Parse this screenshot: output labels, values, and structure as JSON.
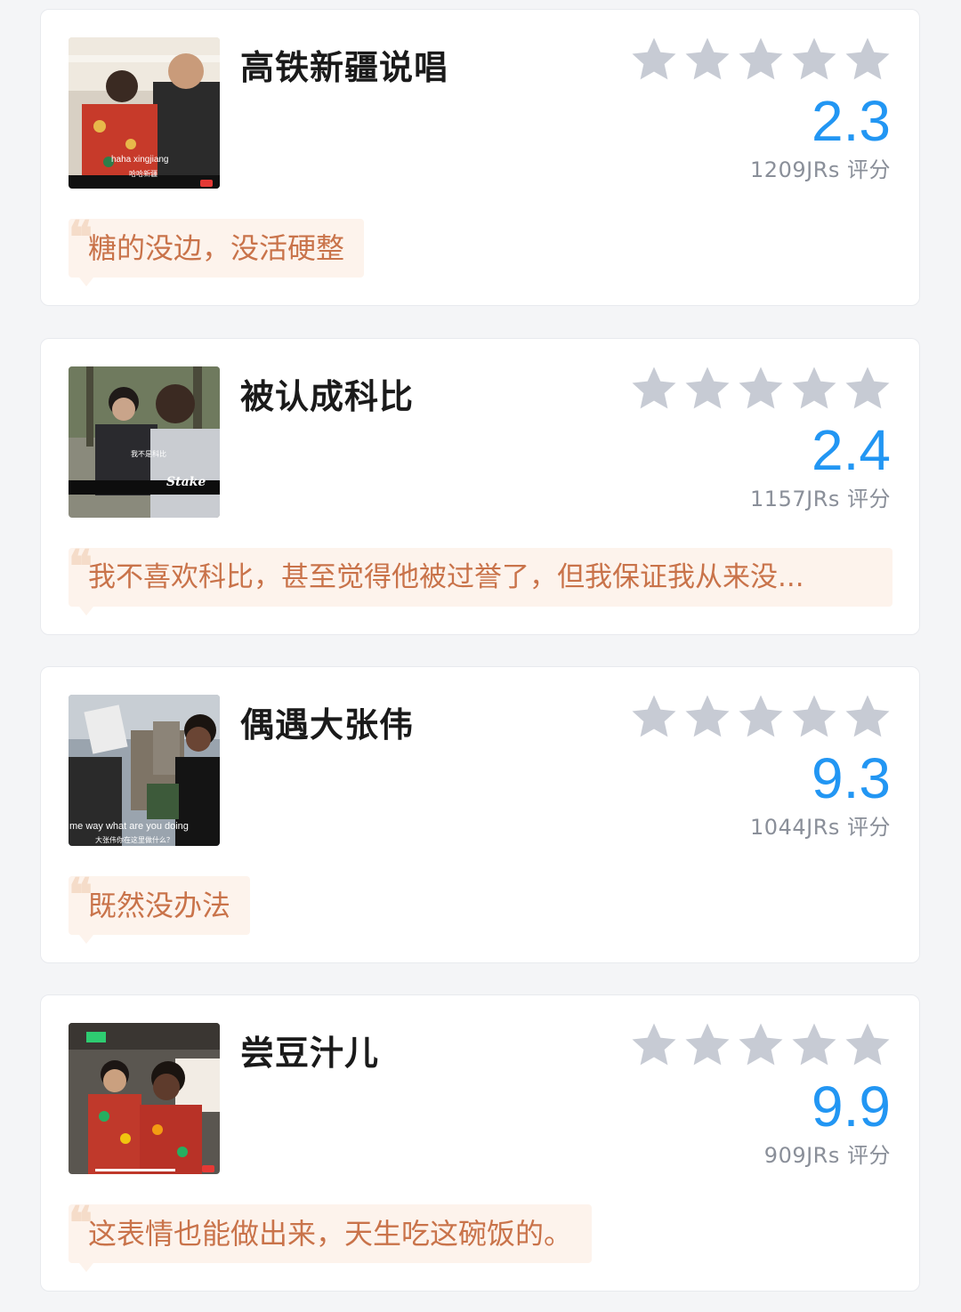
{
  "star_color": "#c7cbd4",
  "score_color": "#2296f3",
  "quote_color": "#c9734a",
  "items": [
    {
      "title": "高铁新疆说唱",
      "score": "2.3",
      "count": "1209JRs 评分",
      "quote": "糖的没边，没活硬整",
      "thumb_caption": "haha xingjiang",
      "thumb_caption2": "哈哈新疆",
      "thumb_icon": "video-thumbnail"
    },
    {
      "title": "被认成科比",
      "score": "2.4",
      "count": "1157JRs 评分",
      "quote": "我不喜欢科比，甚至觉得他被过誉了，但我保证我从来没...",
      "thumb_caption": "我不是科比",
      "thumb_caption2": "Stake",
      "thumb_icon": "video-thumbnail"
    },
    {
      "title": "偶遇大张伟",
      "score": "9.3",
      "count": "1044JRs 评分",
      "quote": "既然没办法",
      "thumb_caption": "me way what are you doing",
      "thumb_caption2": "大张伟你在这里做什么？",
      "thumb_icon": "video-thumbnail"
    },
    {
      "title": "尝豆汁儿",
      "score": "9.9",
      "count": "909JRs 评分",
      "quote": "这表情也能做出来，天生吃这碗饭的。",
      "thumb_caption": "",
      "thumb_caption2": "",
      "thumb_icon": "video-thumbnail"
    }
  ]
}
